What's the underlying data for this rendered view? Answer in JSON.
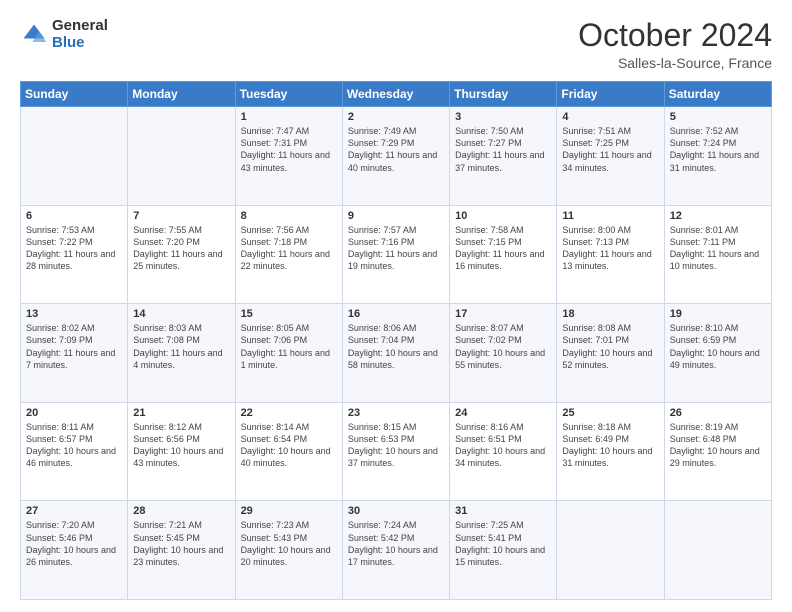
{
  "header": {
    "logo_general": "General",
    "logo_blue": "Blue",
    "title": "October 2024",
    "location": "Salles-la-Source, France"
  },
  "days_of_week": [
    "Sunday",
    "Monday",
    "Tuesday",
    "Wednesday",
    "Thursday",
    "Friday",
    "Saturday"
  ],
  "weeks": [
    [
      {
        "day": "",
        "sunrise": "",
        "sunset": "",
        "daylight": ""
      },
      {
        "day": "",
        "sunrise": "",
        "sunset": "",
        "daylight": ""
      },
      {
        "day": "1",
        "sunrise": "Sunrise: 7:47 AM",
        "sunset": "Sunset: 7:31 PM",
        "daylight": "Daylight: 11 hours and 43 minutes."
      },
      {
        "day": "2",
        "sunrise": "Sunrise: 7:49 AM",
        "sunset": "Sunset: 7:29 PM",
        "daylight": "Daylight: 11 hours and 40 minutes."
      },
      {
        "day": "3",
        "sunrise": "Sunrise: 7:50 AM",
        "sunset": "Sunset: 7:27 PM",
        "daylight": "Daylight: 11 hours and 37 minutes."
      },
      {
        "day": "4",
        "sunrise": "Sunrise: 7:51 AM",
        "sunset": "Sunset: 7:25 PM",
        "daylight": "Daylight: 11 hours and 34 minutes."
      },
      {
        "day": "5",
        "sunrise": "Sunrise: 7:52 AM",
        "sunset": "Sunset: 7:24 PM",
        "daylight": "Daylight: 11 hours and 31 minutes."
      }
    ],
    [
      {
        "day": "6",
        "sunrise": "Sunrise: 7:53 AM",
        "sunset": "Sunset: 7:22 PM",
        "daylight": "Daylight: 11 hours and 28 minutes."
      },
      {
        "day": "7",
        "sunrise": "Sunrise: 7:55 AM",
        "sunset": "Sunset: 7:20 PM",
        "daylight": "Daylight: 11 hours and 25 minutes."
      },
      {
        "day": "8",
        "sunrise": "Sunrise: 7:56 AM",
        "sunset": "Sunset: 7:18 PM",
        "daylight": "Daylight: 11 hours and 22 minutes."
      },
      {
        "day": "9",
        "sunrise": "Sunrise: 7:57 AM",
        "sunset": "Sunset: 7:16 PM",
        "daylight": "Daylight: 11 hours and 19 minutes."
      },
      {
        "day": "10",
        "sunrise": "Sunrise: 7:58 AM",
        "sunset": "Sunset: 7:15 PM",
        "daylight": "Daylight: 11 hours and 16 minutes."
      },
      {
        "day": "11",
        "sunrise": "Sunrise: 8:00 AM",
        "sunset": "Sunset: 7:13 PM",
        "daylight": "Daylight: 11 hours and 13 minutes."
      },
      {
        "day": "12",
        "sunrise": "Sunrise: 8:01 AM",
        "sunset": "Sunset: 7:11 PM",
        "daylight": "Daylight: 11 hours and 10 minutes."
      }
    ],
    [
      {
        "day": "13",
        "sunrise": "Sunrise: 8:02 AM",
        "sunset": "Sunset: 7:09 PM",
        "daylight": "Daylight: 11 hours and 7 minutes."
      },
      {
        "day": "14",
        "sunrise": "Sunrise: 8:03 AM",
        "sunset": "Sunset: 7:08 PM",
        "daylight": "Daylight: 11 hours and 4 minutes."
      },
      {
        "day": "15",
        "sunrise": "Sunrise: 8:05 AM",
        "sunset": "Sunset: 7:06 PM",
        "daylight": "Daylight: 11 hours and 1 minute."
      },
      {
        "day": "16",
        "sunrise": "Sunrise: 8:06 AM",
        "sunset": "Sunset: 7:04 PM",
        "daylight": "Daylight: 10 hours and 58 minutes."
      },
      {
        "day": "17",
        "sunrise": "Sunrise: 8:07 AM",
        "sunset": "Sunset: 7:02 PM",
        "daylight": "Daylight: 10 hours and 55 minutes."
      },
      {
        "day": "18",
        "sunrise": "Sunrise: 8:08 AM",
        "sunset": "Sunset: 7:01 PM",
        "daylight": "Daylight: 10 hours and 52 minutes."
      },
      {
        "day": "19",
        "sunrise": "Sunrise: 8:10 AM",
        "sunset": "Sunset: 6:59 PM",
        "daylight": "Daylight: 10 hours and 49 minutes."
      }
    ],
    [
      {
        "day": "20",
        "sunrise": "Sunrise: 8:11 AM",
        "sunset": "Sunset: 6:57 PM",
        "daylight": "Daylight: 10 hours and 46 minutes."
      },
      {
        "day": "21",
        "sunrise": "Sunrise: 8:12 AM",
        "sunset": "Sunset: 6:56 PM",
        "daylight": "Daylight: 10 hours and 43 minutes."
      },
      {
        "day": "22",
        "sunrise": "Sunrise: 8:14 AM",
        "sunset": "Sunset: 6:54 PM",
        "daylight": "Daylight: 10 hours and 40 minutes."
      },
      {
        "day": "23",
        "sunrise": "Sunrise: 8:15 AM",
        "sunset": "Sunset: 6:53 PM",
        "daylight": "Daylight: 10 hours and 37 minutes."
      },
      {
        "day": "24",
        "sunrise": "Sunrise: 8:16 AM",
        "sunset": "Sunset: 6:51 PM",
        "daylight": "Daylight: 10 hours and 34 minutes."
      },
      {
        "day": "25",
        "sunrise": "Sunrise: 8:18 AM",
        "sunset": "Sunset: 6:49 PM",
        "daylight": "Daylight: 10 hours and 31 minutes."
      },
      {
        "day": "26",
        "sunrise": "Sunrise: 8:19 AM",
        "sunset": "Sunset: 6:48 PM",
        "daylight": "Daylight: 10 hours and 29 minutes."
      }
    ],
    [
      {
        "day": "27",
        "sunrise": "Sunrise: 7:20 AM",
        "sunset": "Sunset: 5:46 PM",
        "daylight": "Daylight: 10 hours and 26 minutes."
      },
      {
        "day": "28",
        "sunrise": "Sunrise: 7:21 AM",
        "sunset": "Sunset: 5:45 PM",
        "daylight": "Daylight: 10 hours and 23 minutes."
      },
      {
        "day": "29",
        "sunrise": "Sunrise: 7:23 AM",
        "sunset": "Sunset: 5:43 PM",
        "daylight": "Daylight: 10 hours and 20 minutes."
      },
      {
        "day": "30",
        "sunrise": "Sunrise: 7:24 AM",
        "sunset": "Sunset: 5:42 PM",
        "daylight": "Daylight: 10 hours and 17 minutes."
      },
      {
        "day": "31",
        "sunrise": "Sunrise: 7:25 AM",
        "sunset": "Sunset: 5:41 PM",
        "daylight": "Daylight: 10 hours and 15 minutes."
      },
      {
        "day": "",
        "sunrise": "",
        "sunset": "",
        "daylight": ""
      },
      {
        "day": "",
        "sunrise": "",
        "sunset": "",
        "daylight": ""
      }
    ]
  ]
}
